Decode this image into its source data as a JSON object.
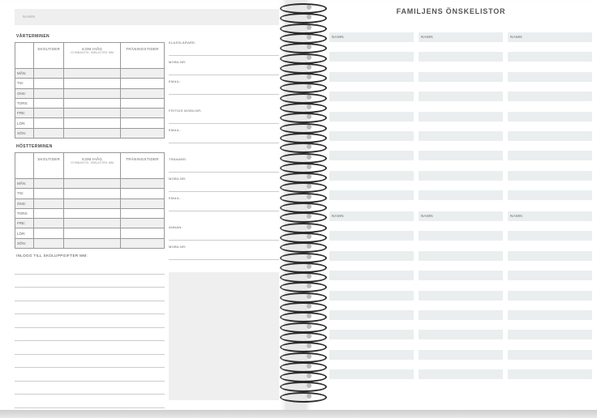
{
  "left_page": {
    "name_label": "NAMN",
    "spring": {
      "title": "VÅRTERMINEN",
      "headers": [
        "SKOLTIDER",
        "KOM IHÅG",
        "TRÄNINGSTIDER"
      ],
      "subheader": "GYMNASTIK, BIBLIOTEK MM",
      "days": [
        "MÅN:",
        "TIS:",
        "ONS:",
        "TORS:",
        "FRE:",
        "LÖR:",
        "SÖN:"
      ]
    },
    "autumn": {
      "title": "HÖSTTERMINEN",
      "headers": [
        "SKOLTIDER",
        "KOM IHÅG",
        "TRÄNINGSTIDER"
      ],
      "subheader": "GYMNASTIK, BIBLIOTEK MM",
      "days": [
        "MÅN:",
        "TIS:",
        "ONS:",
        "TORS:",
        "FRE:",
        "LÖR:",
        "SÖN:"
      ]
    },
    "login_title": "INLOGG TILL SKOLUPPGIFTER MM:",
    "contacts": [
      {
        "label": "KLASSLÄRARE:"
      },
      {
        "label": "MOBILNR:"
      },
      {
        "label": "EMAIL:"
      },
      {
        "label": "FRITIDS MOBILNR:"
      },
      {
        "label": "EMAIL:"
      },
      {
        "label": "TRÄNARE:"
      },
      {
        "label": "MOBILNR:"
      },
      {
        "label": "EMAIL:"
      },
      {
        "label": "ANNAN:"
      },
      {
        "label": "MOBILNR:"
      }
    ]
  },
  "right_page": {
    "title": "FAMILJENS ÖNSKELISTOR",
    "name_label": "NAMN",
    "name_label_b": "NAMN:"
  },
  "colors": {
    "bar": "#eaeeee",
    "page": "#ffffff",
    "ring": "#2b2b2b"
  }
}
